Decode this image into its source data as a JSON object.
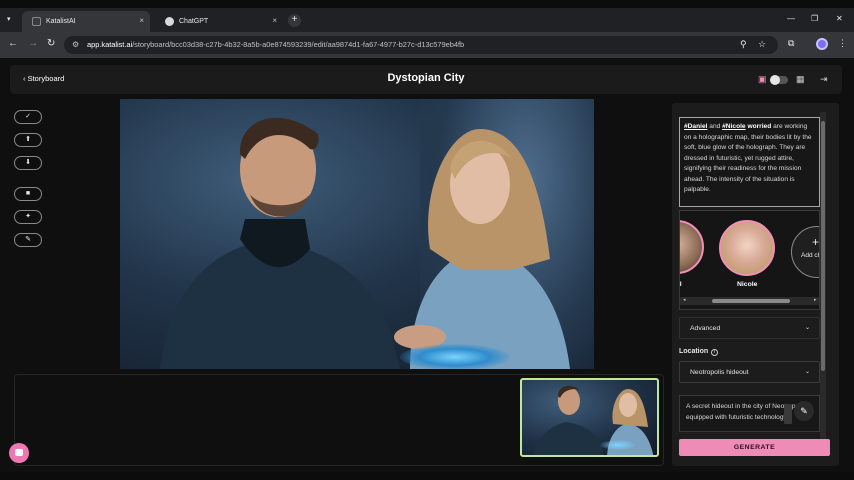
{
  "browser": {
    "tabs": [
      {
        "title": "KatalistAI",
        "active": true,
        "close": "×"
      },
      {
        "title": "ChatGPT",
        "active": false,
        "close": "×"
      }
    ],
    "new_tab": "+",
    "tab_menu": "▾",
    "window_controls": {
      "minimize": "—",
      "restore": "❐",
      "close": "✕"
    },
    "nav": {
      "back": "←",
      "forward": "→",
      "reload": "↻"
    },
    "url_host": "app.katalist.ai",
    "url_path": "/storyboard/bcc03d38-c27b-4b32-8a5b-a0e874593239/edit/aa9874d1-fa67-4977-b27c-d13c579eb4fb",
    "site_info_icon": "site-info-icon",
    "toolbar_icons": {
      "zoom": "⚲",
      "bookmark": "☆",
      "extensions": "⧉",
      "menu": "⋮"
    }
  },
  "header": {
    "back_label": "Storyboard",
    "back_glyph": "‹",
    "title": "Dystopian City",
    "icons": {
      "image": "▣",
      "grid": "▦",
      "collapse": "⇥"
    }
  },
  "left_tools": [
    {
      "name": "check-tool",
      "glyph": "✓"
    },
    {
      "name": "upload-tool",
      "glyph": "⬆"
    },
    {
      "name": "download-tool",
      "glyph": "⬇"
    },
    {
      "name": "crop-tool",
      "glyph": "■"
    },
    {
      "name": "pin-tool",
      "glyph": "✦"
    },
    {
      "name": "brush-tool",
      "glyph": "✎"
    }
  ],
  "scene": {
    "description_parts": [
      {
        "text": "#Daniel",
        "style": "tag"
      },
      {
        "text": " and ",
        "style": "plain"
      },
      {
        "text": "#Nicole",
        "style": "tag"
      },
      {
        "text": " worried",
        "style": "bold"
      },
      {
        "text": " are working on a holographic map, their bodies lit by the soft, blue glow of the holograph. They are dressed in futuristic, yet rugged attire, signifying their readiness for the mission ahead. The intensity of the situation is palpable.",
        "style": "plain"
      }
    ],
    "characters": [
      {
        "name": "el"
      },
      {
        "name": "Nicole"
      }
    ],
    "add_character": {
      "plus": "+",
      "label": "Add chara"
    },
    "hscroll_left": "◂",
    "hscroll_right": "▸",
    "advanced_label": "Advanced",
    "location_label": "Location",
    "location_info": "i",
    "location_value": "Neotropolis hideout",
    "location_description": "A secret hideout in the city of Neotropolis equipped with futuristic technology",
    "edit_glyph": "✎",
    "chevron": "⌄",
    "generate_label": "GENERATE"
  },
  "colors": {
    "accent_pink": "#ee8bb7",
    "thumbnail_border": "#c0e89d",
    "panel_bg": "#1c1c1c"
  }
}
